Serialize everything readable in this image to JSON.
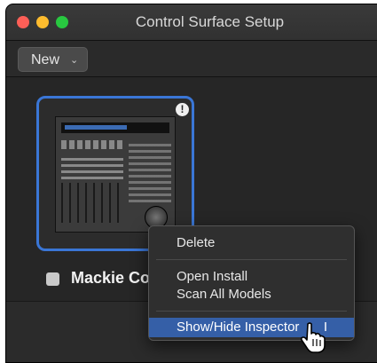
{
  "window": {
    "title": "Control Surface Setup"
  },
  "toolbar": {
    "new_label": "New",
    "new_chevron": "⌄"
  },
  "device": {
    "name": "Mackie Co",
    "warning_glyph": "!"
  },
  "context_menu": {
    "items": [
      {
        "label": "Delete"
      },
      {
        "label": "Open Install"
      },
      {
        "label": "Scan All Models"
      },
      {
        "label": "Show/Hide Inspector",
        "shortcut": "I",
        "highlighted": true
      }
    ]
  },
  "colors": {
    "selection": "#3a76d6",
    "menu_highlight": "#355fa7",
    "traffic_red": "#fe5f57",
    "traffic_yellow": "#febc2e",
    "traffic_green": "#28c840"
  },
  "cursor": "pointing-hand"
}
